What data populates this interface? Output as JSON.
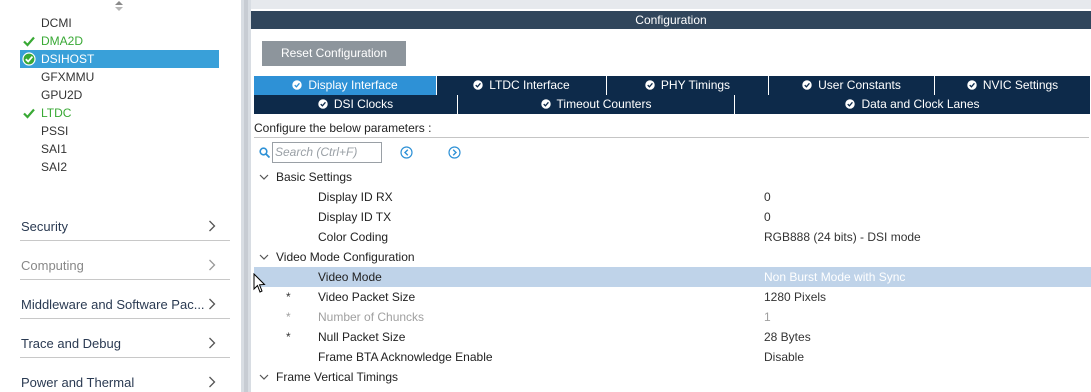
{
  "left": {
    "peripherals": [
      {
        "label": "DCMI",
        "status": "none"
      },
      {
        "label": "DMA2D",
        "status": "ok"
      },
      {
        "label": "DSIHOST",
        "status": "selected"
      },
      {
        "label": "GFXMMU",
        "status": "none"
      },
      {
        "label": "GPU2D",
        "status": "none"
      },
      {
        "label": "LTDC",
        "status": "ok"
      },
      {
        "label": "PSSI",
        "status": "none"
      },
      {
        "label": "SAI1",
        "status": "none"
      },
      {
        "label": "SAI2",
        "status": "none"
      }
    ],
    "categories": [
      {
        "label": "Security",
        "dim": false
      },
      {
        "label": "Computing",
        "dim": true
      },
      {
        "label": "Middleware and Software Pac...",
        "dim": false
      },
      {
        "label": "Trace and Debug",
        "dim": false
      },
      {
        "label": "Power and Thermal",
        "dim": false
      }
    ]
  },
  "config": {
    "header": "Configuration",
    "reset_label": "Reset Configuration",
    "tabs_row1": [
      "Display Interface",
      "LTDC Interface",
      "PHY Timings",
      "User Constants",
      "NVIC Settings"
    ],
    "tabs_row2": [
      "DSI Clocks",
      "Timeout Counters",
      "Data and Clock Lanes"
    ],
    "active_tab": "Display Interface",
    "instruction": "Configure the below parameters :",
    "search_placeholder": "Search (Ctrl+F)",
    "rows": [
      {
        "kind": "group",
        "label": "Basic Settings"
      },
      {
        "kind": "param",
        "name": "Display ID RX",
        "value": "0"
      },
      {
        "kind": "param",
        "name": "Display ID TX",
        "value": "0"
      },
      {
        "kind": "param",
        "name": "Color Coding",
        "value": "RGB888 (24 bits) - DSI mode"
      },
      {
        "kind": "group",
        "label": "Video Mode Configuration"
      },
      {
        "kind": "param",
        "name": "Video Mode",
        "value": "Non Burst Mode with Sync",
        "highlight": true
      },
      {
        "kind": "param",
        "name": "Video Packet Size",
        "value": "1280 Pixels",
        "star": true
      },
      {
        "kind": "param",
        "name": "Number of Chuncks",
        "value": "1",
        "star": true,
        "dim": true
      },
      {
        "kind": "param",
        "name": "Null Packet Size",
        "value": "28 Bytes",
        "star": true
      },
      {
        "kind": "param",
        "name": "Frame BTA Acknowledge Enable",
        "value": "Disable"
      },
      {
        "kind": "group",
        "label": "Frame Vertical Timings"
      }
    ]
  },
  "colors": {
    "accent_green": "#39a935",
    "selected_blue": "#39a0d9",
    "tab_dark": "#0d2a4a",
    "tab_active": "#2e91d6",
    "header_bg": "#31465c",
    "row_highlight": "#bfd3e9"
  },
  "icons": {
    "check": "check-icon",
    "chevron": "chevron-right-icon",
    "expand": "chevron-down-icon",
    "search": "search-icon",
    "prev": "arrow-left-circle-icon",
    "next": "arrow-right-circle-icon"
  }
}
